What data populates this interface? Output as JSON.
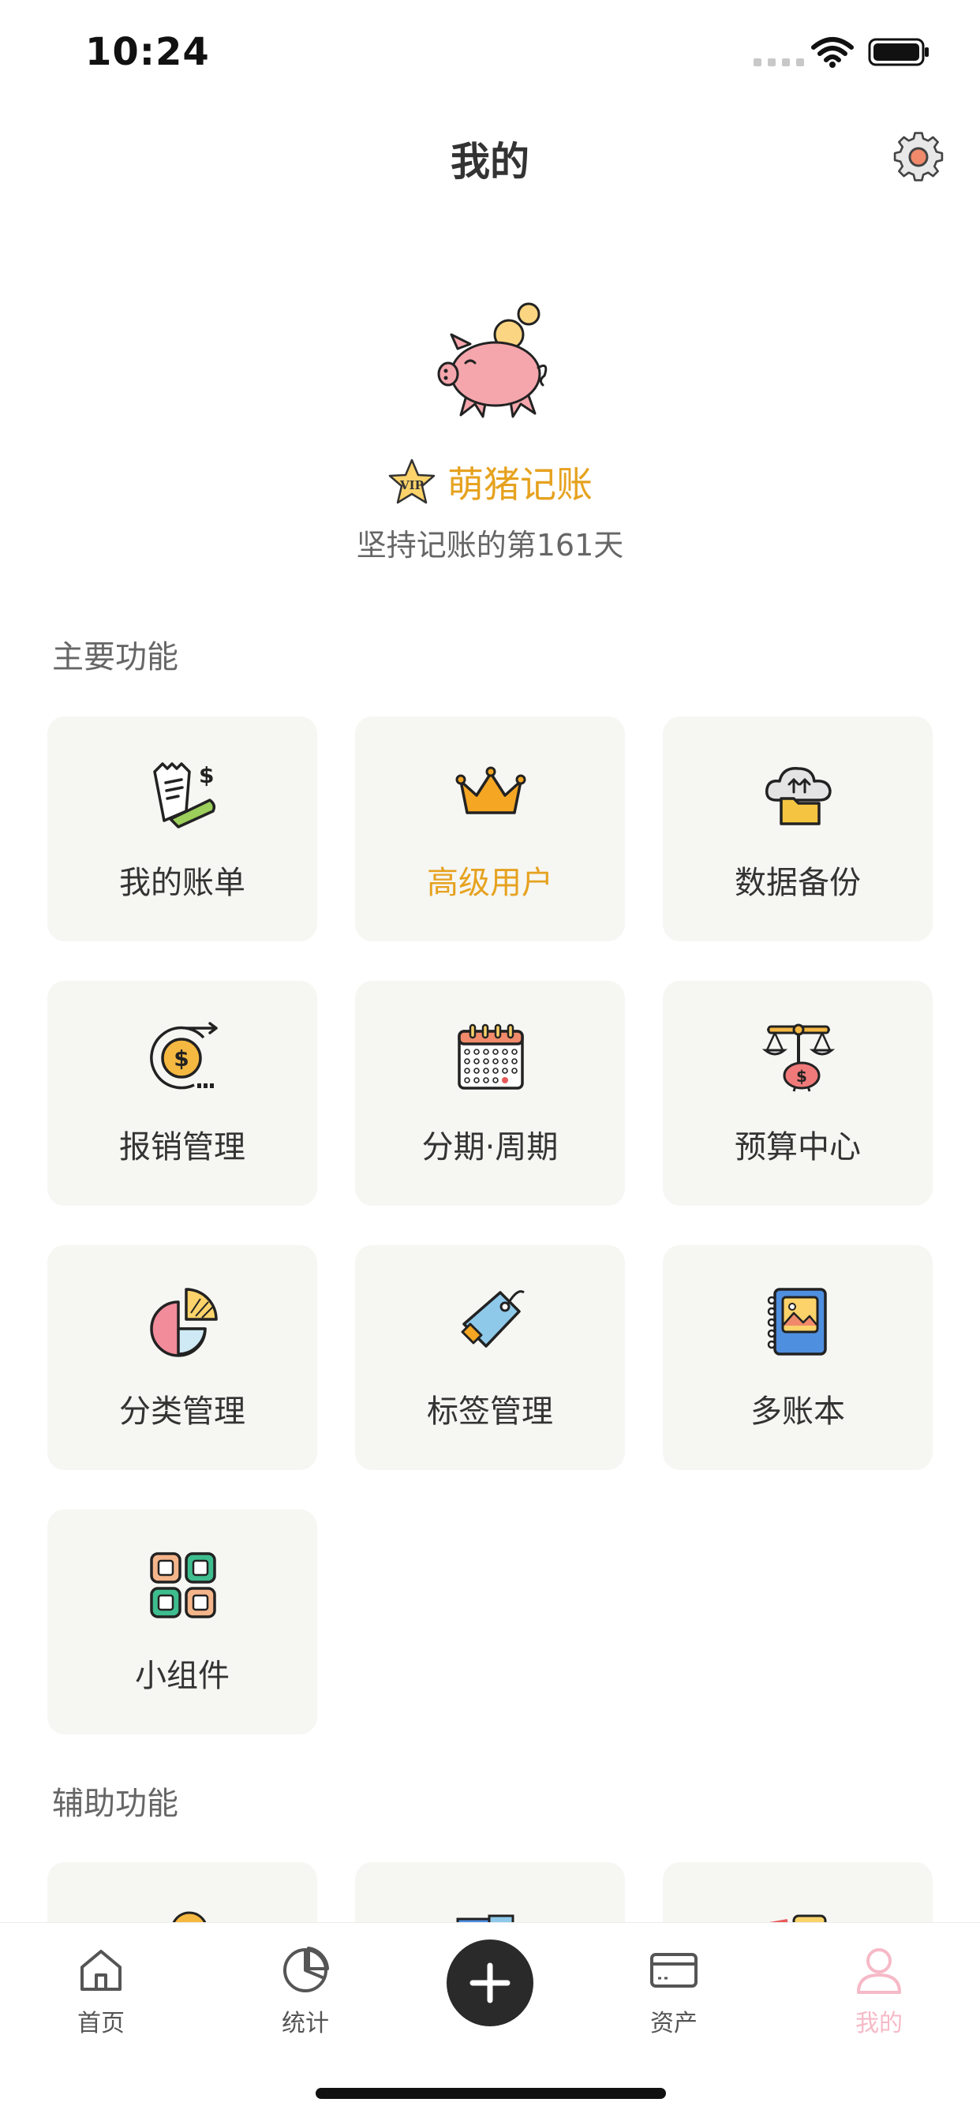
{
  "status_bar": {
    "time": "10:24"
  },
  "header": {
    "title": "我的"
  },
  "profile": {
    "app_name": "萌猪记账",
    "vip_text": "VIP",
    "streak": "坚持记账的第161天"
  },
  "sections": {
    "main_title": "主要功能",
    "aux_title": "辅助功能"
  },
  "main_features": [
    {
      "label": "我的账单",
      "icon": "receipt-money-icon"
    },
    {
      "label": "高级用户",
      "icon": "crown-icon"
    },
    {
      "label": "数据备份",
      "icon": "cloud-folder-icon"
    },
    {
      "label": "报销管理",
      "icon": "coin-refund-icon"
    },
    {
      "label": "分期·周期",
      "icon": "calendar-icon"
    },
    {
      "label": "预算中心",
      "icon": "balance-scale-pig-icon"
    },
    {
      "label": "分类管理",
      "icon": "pie-chart-icon"
    },
    {
      "label": "标签管理",
      "icon": "price-tag-icon"
    },
    {
      "label": "多账本",
      "icon": "notebook-icon"
    },
    {
      "label": "小组件",
      "icon": "widget-grid-icon"
    }
  ],
  "tabs": [
    {
      "label": "首页",
      "icon": "home-icon"
    },
    {
      "label": "统计",
      "icon": "pie-stats-icon"
    },
    {
      "label": "资产",
      "icon": "card-icon"
    },
    {
      "label": "我的",
      "icon": "profile-icon"
    }
  ],
  "colors": {
    "accent_gold": "#e6a21f",
    "active_tab": "#f6b9c7",
    "card_bg": "#f6f6f3"
  }
}
